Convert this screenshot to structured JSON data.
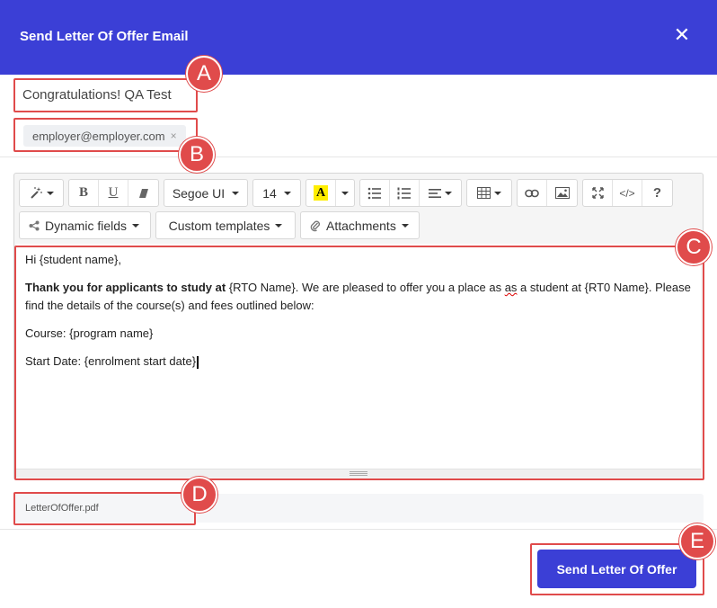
{
  "dialog": {
    "title": "Send Letter Of Offer Email",
    "close_icon": "close-icon"
  },
  "subject": "Congratulations! QA Test",
  "recipients": [
    {
      "email": "employer@employer.com",
      "remove": "×"
    }
  ],
  "toolbar": {
    "style_icon": "magic-wand-icon",
    "bold": "B",
    "underline": "U",
    "eraser_icon": "eraser-icon",
    "font_family": "Segoe UI",
    "font_size": "14",
    "highlight_letter": "A",
    "highlight_color": "#ffee00",
    "unordered_list_icon": "unordered-list-icon",
    "ordered_list_icon": "ordered-list-icon",
    "align_icon": "align-icon",
    "table_icon": "table-icon",
    "link_icon": "link-icon",
    "picture_icon": "picture-icon",
    "fullscreen_icon": "fullscreen-icon",
    "code_view": "</>",
    "help": "?",
    "dynamic_fields": "Dynamic fields",
    "custom_templates": "Custom templates",
    "attachments": "Attachments"
  },
  "body": {
    "greeting": "Hi {student name},",
    "p1_bold": "Thank you for applicants to study at",
    "p1_a": " {RTO Name}. We are pleased to offer you a place as ",
    "p1_misspelled": "as",
    "p1_b": " a student at {RT0 Name}. Please find the details of the course(s) and fees outlined below:",
    "course": "Course: {program name}",
    "start_date": "Start Date: {enrolment start date}"
  },
  "attachment_file": "LetterOfOffer.pdf",
  "send_button": "Send Letter Of Offer",
  "annotations": [
    "A",
    "B",
    "C",
    "D",
    "E"
  ],
  "colors": {
    "header": "#3b3fd6",
    "primary_button": "#3b3fd6",
    "annotation": "#e04b4b"
  }
}
